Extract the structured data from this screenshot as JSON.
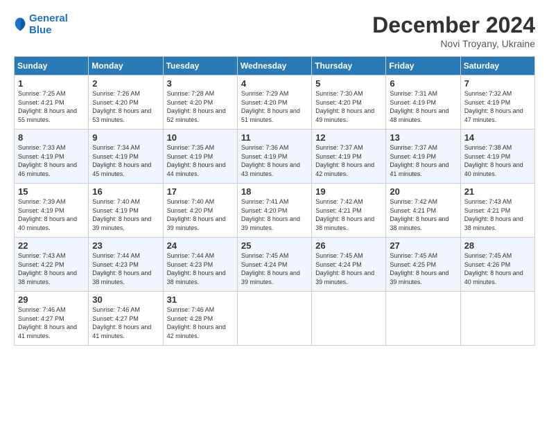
{
  "logo": {
    "line1": "General",
    "line2": "Blue"
  },
  "title": "December 2024",
  "location": "Novi Troyany, Ukraine",
  "days_of_week": [
    "Sunday",
    "Monday",
    "Tuesday",
    "Wednesday",
    "Thursday",
    "Friday",
    "Saturday"
  ],
  "weeks": [
    [
      {
        "day": "1",
        "sunrise": "Sunrise: 7:25 AM",
        "sunset": "Sunset: 4:21 PM",
        "daylight": "Daylight: 8 hours and 55 minutes."
      },
      {
        "day": "2",
        "sunrise": "Sunrise: 7:26 AM",
        "sunset": "Sunset: 4:20 PM",
        "daylight": "Daylight: 8 hours and 53 minutes."
      },
      {
        "day": "3",
        "sunrise": "Sunrise: 7:28 AM",
        "sunset": "Sunset: 4:20 PM",
        "daylight": "Daylight: 8 hours and 52 minutes."
      },
      {
        "day": "4",
        "sunrise": "Sunrise: 7:29 AM",
        "sunset": "Sunset: 4:20 PM",
        "daylight": "Daylight: 8 hours and 51 minutes."
      },
      {
        "day": "5",
        "sunrise": "Sunrise: 7:30 AM",
        "sunset": "Sunset: 4:20 PM",
        "daylight": "Daylight: 8 hours and 49 minutes."
      },
      {
        "day": "6",
        "sunrise": "Sunrise: 7:31 AM",
        "sunset": "Sunset: 4:19 PM",
        "daylight": "Daylight: 8 hours and 48 minutes."
      },
      {
        "day": "7",
        "sunrise": "Sunrise: 7:32 AM",
        "sunset": "Sunset: 4:19 PM",
        "daylight": "Daylight: 8 hours and 47 minutes."
      }
    ],
    [
      {
        "day": "8",
        "sunrise": "Sunrise: 7:33 AM",
        "sunset": "Sunset: 4:19 PM",
        "daylight": "Daylight: 8 hours and 46 minutes."
      },
      {
        "day": "9",
        "sunrise": "Sunrise: 7:34 AM",
        "sunset": "Sunset: 4:19 PM",
        "daylight": "Daylight: 8 hours and 45 minutes."
      },
      {
        "day": "10",
        "sunrise": "Sunrise: 7:35 AM",
        "sunset": "Sunset: 4:19 PM",
        "daylight": "Daylight: 8 hours and 44 minutes."
      },
      {
        "day": "11",
        "sunrise": "Sunrise: 7:36 AM",
        "sunset": "Sunset: 4:19 PM",
        "daylight": "Daylight: 8 hours and 43 minutes."
      },
      {
        "day": "12",
        "sunrise": "Sunrise: 7:37 AM",
        "sunset": "Sunset: 4:19 PM",
        "daylight": "Daylight: 8 hours and 42 minutes."
      },
      {
        "day": "13",
        "sunrise": "Sunrise: 7:37 AM",
        "sunset": "Sunset: 4:19 PM",
        "daylight": "Daylight: 8 hours and 41 minutes."
      },
      {
        "day": "14",
        "sunrise": "Sunrise: 7:38 AM",
        "sunset": "Sunset: 4:19 PM",
        "daylight": "Daylight: 8 hours and 40 minutes."
      }
    ],
    [
      {
        "day": "15",
        "sunrise": "Sunrise: 7:39 AM",
        "sunset": "Sunset: 4:19 PM",
        "daylight": "Daylight: 8 hours and 40 minutes."
      },
      {
        "day": "16",
        "sunrise": "Sunrise: 7:40 AM",
        "sunset": "Sunset: 4:19 PM",
        "daylight": "Daylight: 8 hours and 39 minutes."
      },
      {
        "day": "17",
        "sunrise": "Sunrise: 7:40 AM",
        "sunset": "Sunset: 4:20 PM",
        "daylight": "Daylight: 8 hours and 39 minutes."
      },
      {
        "day": "18",
        "sunrise": "Sunrise: 7:41 AM",
        "sunset": "Sunset: 4:20 PM",
        "daylight": "Daylight: 8 hours and 39 minutes."
      },
      {
        "day": "19",
        "sunrise": "Sunrise: 7:42 AM",
        "sunset": "Sunset: 4:21 PM",
        "daylight": "Daylight: 8 hours and 38 minutes."
      },
      {
        "day": "20",
        "sunrise": "Sunrise: 7:42 AM",
        "sunset": "Sunset: 4:21 PM",
        "daylight": "Daylight: 8 hours and 38 minutes."
      },
      {
        "day": "21",
        "sunrise": "Sunrise: 7:43 AM",
        "sunset": "Sunset: 4:21 PM",
        "daylight": "Daylight: 8 hours and 38 minutes."
      }
    ],
    [
      {
        "day": "22",
        "sunrise": "Sunrise: 7:43 AM",
        "sunset": "Sunset: 4:22 PM",
        "daylight": "Daylight: 8 hours and 38 minutes."
      },
      {
        "day": "23",
        "sunrise": "Sunrise: 7:44 AM",
        "sunset": "Sunset: 4:23 PM",
        "daylight": "Daylight: 8 hours and 38 minutes."
      },
      {
        "day": "24",
        "sunrise": "Sunrise: 7:44 AM",
        "sunset": "Sunset: 4:23 PM",
        "daylight": "Daylight: 8 hours and 38 minutes."
      },
      {
        "day": "25",
        "sunrise": "Sunrise: 7:45 AM",
        "sunset": "Sunset: 4:24 PM",
        "daylight": "Daylight: 8 hours and 39 minutes."
      },
      {
        "day": "26",
        "sunrise": "Sunrise: 7:45 AM",
        "sunset": "Sunset: 4:24 PM",
        "daylight": "Daylight: 8 hours and 39 minutes."
      },
      {
        "day": "27",
        "sunrise": "Sunrise: 7:45 AM",
        "sunset": "Sunset: 4:25 PM",
        "daylight": "Daylight: 8 hours and 39 minutes."
      },
      {
        "day": "28",
        "sunrise": "Sunrise: 7:45 AM",
        "sunset": "Sunset: 4:26 PM",
        "daylight": "Daylight: 8 hours and 40 minutes."
      }
    ],
    [
      {
        "day": "29",
        "sunrise": "Sunrise: 7:46 AM",
        "sunset": "Sunset: 4:27 PM",
        "daylight": "Daylight: 8 hours and 41 minutes."
      },
      {
        "day": "30",
        "sunrise": "Sunrise: 7:46 AM",
        "sunset": "Sunset: 4:27 PM",
        "daylight": "Daylight: 8 hours and 41 minutes."
      },
      {
        "day": "31",
        "sunrise": "Sunrise: 7:46 AM",
        "sunset": "Sunset: 4:28 PM",
        "daylight": "Daylight: 8 hours and 42 minutes."
      },
      null,
      null,
      null,
      null
    ]
  ]
}
